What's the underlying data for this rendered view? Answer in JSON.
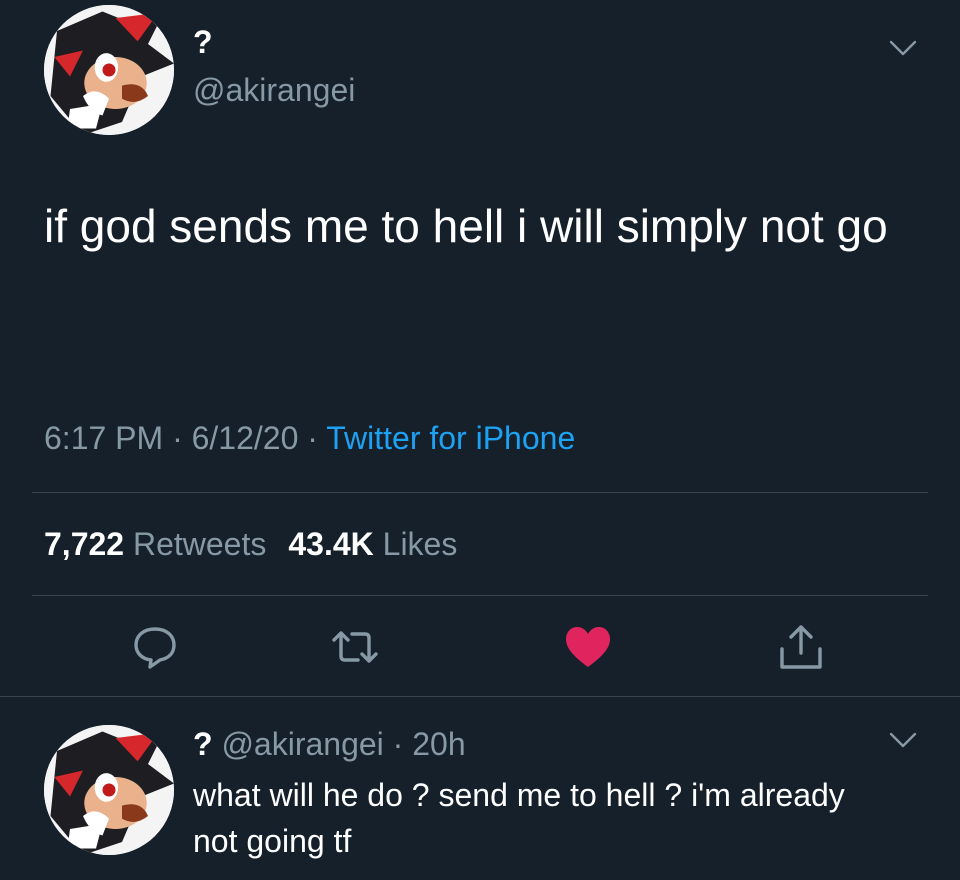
{
  "tweet": {
    "display_name": "?",
    "handle": "@akirangei",
    "text": "if god sends me to hell i will simply not go",
    "time": "6:17 PM",
    "date": "6/12/20",
    "separator": "·",
    "source": "Twitter for iPhone",
    "retweets_count": "7,722",
    "retweets_label": "Retweets",
    "likes_count": "43.4K",
    "likes_label": "Likes",
    "liked": true
  },
  "reply": {
    "display_name": "?",
    "handle": "@akirangei",
    "separator": "·",
    "age": "20h",
    "text": "what will he do ? send me to hell ? i'm already not going tf"
  },
  "colors": {
    "background": "#15202b",
    "secondary_text": "#8899a6",
    "link": "#1da1f2",
    "like": "#e0245e",
    "divider": "#38444d"
  },
  "icons": {
    "avatar": "shadow-hedgehog-avatar",
    "menu": "chevron-down-icon",
    "reply": "reply-bubble-icon",
    "retweet": "retweet-icon",
    "like": "heart-filled-icon",
    "share": "share-icon"
  }
}
